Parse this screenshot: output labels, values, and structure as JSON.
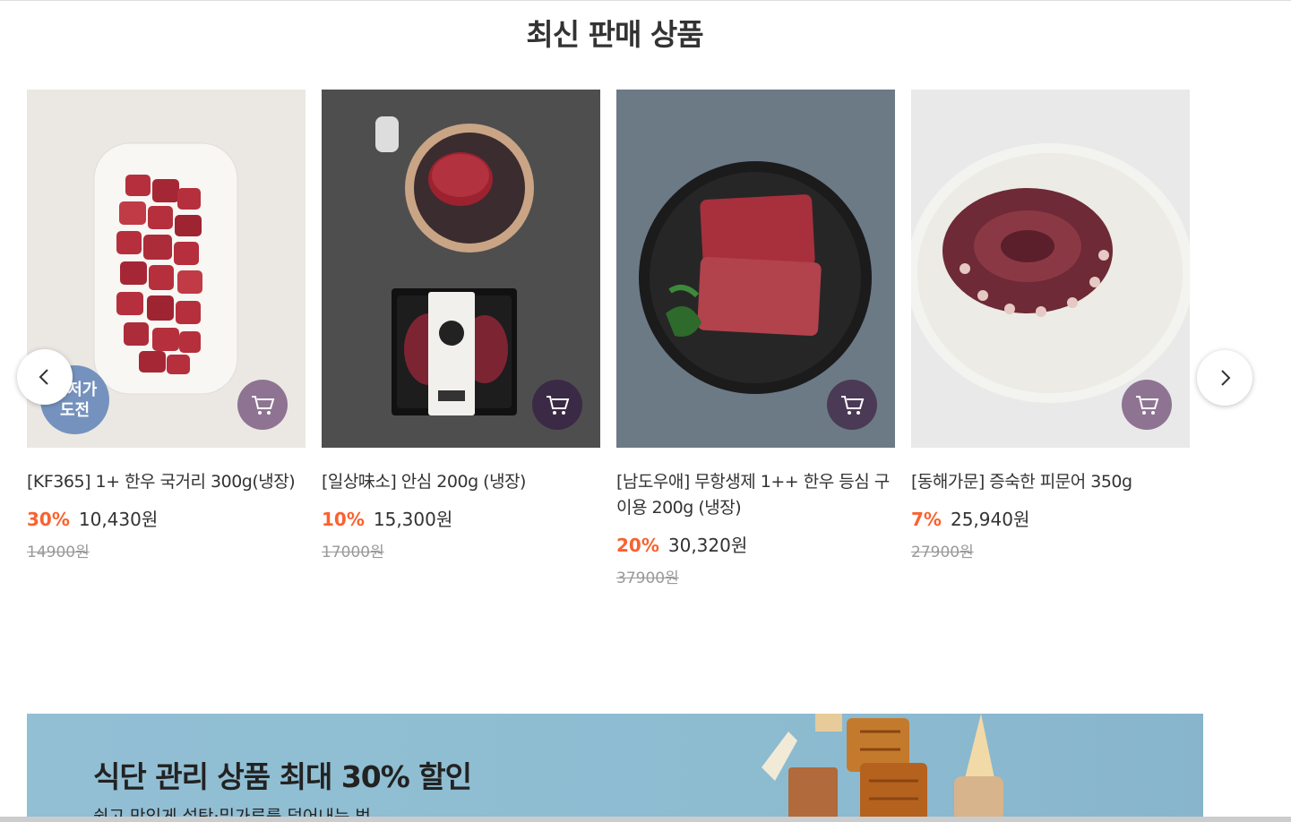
{
  "section": {
    "title": "최신 판매 상품"
  },
  "products": [
    {
      "name": "[KF365] 1+ 한우 국거리 300g(냉장)",
      "discount": "30%",
      "price": "10,430원",
      "original_price": "14900원",
      "badge": [
        "최저가",
        "도전"
      ],
      "cart_color": "#8e7492"
    },
    {
      "name": "[일상味소] 안심 200g (냉장)",
      "discount": "10%",
      "price": "15,300원",
      "original_price": "17000원",
      "cart_color": "#3b2a45"
    },
    {
      "name": "[남도우애] 무항생제 1++ 한우 등심 구이용 200g (냉장)",
      "discount": "20%",
      "price": "30,320원",
      "original_price": "37900원",
      "cart_color": "#4a3a55"
    },
    {
      "name": "[동해가문] 증숙한 피문어 350g",
      "discount": "7%",
      "price": "25,940원",
      "original_price": "27900원",
      "cart_color": "#8e7492"
    }
  ],
  "icons": {
    "prev": "chevron-left-icon",
    "next": "chevron-right-icon",
    "cart": "cart-icon"
  },
  "banner": {
    "title": "식단 관리 상품 최대 30% 할인",
    "subtitle": "쉽고 맛있게 설탕·밀가루를 덜어내는 법"
  },
  "colors": {
    "discount": "#fa622f",
    "badge": "#6083b7",
    "banner_bg": "#8dbcd1"
  }
}
